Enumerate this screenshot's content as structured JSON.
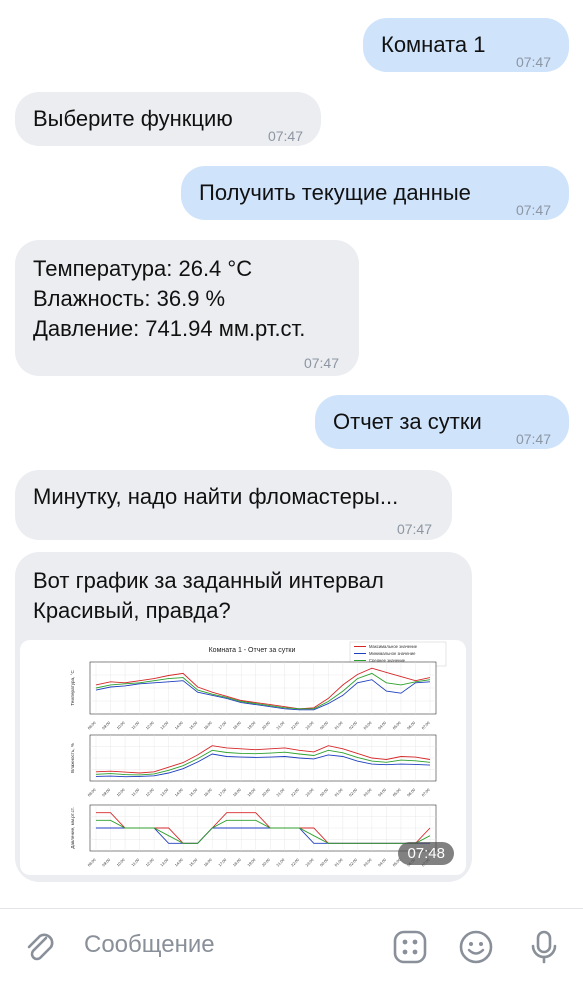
{
  "messages": [
    {
      "dir": "out",
      "text": "Комната 1",
      "time": "07:47"
    },
    {
      "dir": "in",
      "text": "Выберите функцию",
      "time": "07:47"
    },
    {
      "dir": "out",
      "text": "Получить текущие данные",
      "time": "07:47"
    },
    {
      "dir": "in",
      "lines": [
        "Температура: 26.4 °C",
        "Влажность: 36.9 %",
        "Давление: 741.94 мм.рт.ст."
      ],
      "time": "07:47"
    },
    {
      "dir": "out",
      "text": "Отчет за сутки",
      "time": "07:47"
    },
    {
      "dir": "in",
      "text": "Минутку, надо найти фломастеры...",
      "time": "07:47"
    },
    {
      "dir": "in",
      "lines": [
        "Вот график за заданный интервал",
        "Красивый, правда?"
      ],
      "image_time": "07:48"
    }
  ],
  "composer": {
    "placeholder": "Сообщение",
    "icons": [
      "attach-icon",
      "keypad-icon",
      "emoji-icon",
      "microphone-icon"
    ]
  },
  "colors": {
    "outgoing": "#cfe3fb",
    "incoming": "#ebedf0",
    "timestamp": "#8d96a3"
  },
  "chart_data": [
    {
      "type": "line",
      "title": "Комната 1 - Отчет за сутки",
      "legend": [
        "Максимальное значение",
        "Минимальное значение",
        "Среднее значение"
      ],
      "legend_position": "top-right",
      "ylabel": "Температура, °C",
      "x": [
        "08:00",
        "09:00",
        "10:00",
        "11:00",
        "12:00",
        "13:00",
        "14:00",
        "15:00",
        "16:00",
        "17:00",
        "18:00",
        "19:00",
        "20:00",
        "21:00",
        "22:00",
        "23:00",
        "00:00",
        "01:00",
        "02:00",
        "03:00",
        "04:00",
        "05:00",
        "06:00",
        "07:00"
      ],
      "ylim": [
        23,
        28
      ],
      "series": [
        {
          "name": "Максимальное значение",
          "color": "#d62728",
          "values": [
            25.8,
            26.1,
            26.0,
            26.2,
            26.4,
            26.7,
            26.9,
            25.6,
            25.1,
            24.7,
            24.3,
            24.1,
            23.9,
            23.7,
            23.5,
            23.6,
            24.5,
            25.8,
            26.8,
            27.4,
            27.0,
            26.6,
            26.2,
            26.5
          ]
        },
        {
          "name": "Минимальное значение",
          "color": "#1f3fbf",
          "values": [
            25.3,
            25.6,
            25.7,
            25.9,
            26.0,
            26.1,
            26.2,
            25.1,
            24.8,
            24.5,
            24.1,
            23.9,
            23.7,
            23.5,
            23.4,
            23.4,
            24.0,
            24.8,
            26.0,
            26.3,
            25.2,
            25.0,
            26.0,
            26.1
          ]
        },
        {
          "name": "Среднее значение",
          "color": "#2ca02c",
          "values": [
            25.5,
            25.8,
            25.9,
            26.0,
            26.2,
            26.4,
            26.5,
            25.3,
            24.9,
            24.6,
            24.2,
            24.0,
            23.8,
            23.6,
            23.5,
            23.5,
            24.2,
            25.2,
            26.4,
            26.9,
            26.0,
            25.8,
            26.1,
            26.3
          ]
        }
      ]
    },
    {
      "type": "line",
      "ylabel": "Влажность, %",
      "x": [
        "08:00",
        "09:00",
        "10:00",
        "11:00",
        "12:00",
        "13:00",
        "14:00",
        "15:00",
        "16:00",
        "17:00",
        "18:00",
        "19:00",
        "20:00",
        "21:00",
        "22:00",
        "23:00",
        "00:00",
        "01:00",
        "02:00",
        "03:00",
        "04:00",
        "05:00",
        "06:00",
        "07:00"
      ],
      "ylim": [
        30,
        45
      ],
      "series": [
        {
          "name": "Максимальное значение",
          "color": "#d62728",
          "values": [
            33.0,
            33.2,
            32.9,
            32.6,
            33.0,
            34.5,
            36.0,
            38.5,
            41.5,
            40.8,
            40.5,
            40.2,
            40.5,
            40.8,
            40.0,
            39.5,
            41.5,
            40.5,
            39.0,
            37.5,
            37.0,
            38.0,
            37.8,
            37.0
          ]
        },
        {
          "name": "Минимальное значение",
          "color": "#1f3fbf",
          "values": [
            31.5,
            31.6,
            31.4,
            31.5,
            31.7,
            32.6,
            34.0,
            36.2,
            38.8,
            38.0,
            37.8,
            37.7,
            37.8,
            38.0,
            37.5,
            37.2,
            38.5,
            38.0,
            36.5,
            35.5,
            35.3,
            35.5,
            35.4,
            35.2
          ]
        },
        {
          "name": "Среднее значение",
          "color": "#2ca02c",
          "values": [
            32.2,
            32.4,
            32.1,
            32.0,
            32.3,
            33.5,
            35.0,
            37.3,
            40.0,
            39.3,
            39.0,
            38.9,
            39.1,
            39.4,
            38.8,
            38.3,
            40.0,
            39.2,
            37.7,
            36.5,
            36.1,
            36.8,
            36.6,
            36.1
          ]
        }
      ]
    },
    {
      "type": "line",
      "ylabel": "Давление, мм.рт.ст.",
      "x": [
        "08:00",
        "09:00",
        "10:00",
        "11:00",
        "12:00",
        "13:00",
        "14:00",
        "15:00",
        "16:00",
        "17:00",
        "18:00",
        "19:00",
        "20:00",
        "21:00",
        "22:00",
        "23:00",
        "00:00",
        "01:00",
        "02:00",
        "03:00",
        "04:00",
        "05:00",
        "06:00",
        "07:00"
      ],
      "ylim": [
        740.5,
        743.5
      ],
      "series": [
        {
          "name": "Максимальное значение",
          "color": "#d62728",
          "values": [
            743.0,
            743.0,
            742.0,
            742.0,
            742.0,
            742.0,
            741.0,
            741.0,
            742.0,
            743.0,
            743.0,
            743.0,
            742.0,
            742.0,
            742.0,
            742.0,
            741.0,
            741.0,
            741.0,
            741.0,
            741.0,
            741.0,
            741.0,
            742.0
          ]
        },
        {
          "name": "Минимальное значение",
          "color": "#1f3fbf",
          "values": [
            742.0,
            742.0,
            742.0,
            742.0,
            742.0,
            741.0,
            741.0,
            741.0,
            742.0,
            742.0,
            742.0,
            742.0,
            742.0,
            742.0,
            742.0,
            741.0,
            741.0,
            741.0,
            741.0,
            741.0,
            741.0,
            741.0,
            741.0,
            741.0
          ]
        },
        {
          "name": "Среднее значение",
          "color": "#2ca02c",
          "values": [
            742.5,
            742.5,
            742.0,
            742.0,
            742.0,
            741.5,
            741.0,
            741.0,
            742.0,
            742.5,
            742.5,
            742.5,
            742.0,
            742.0,
            742.0,
            741.5,
            741.0,
            741.0,
            741.0,
            741.0,
            741.0,
            741.0,
            741.0,
            741.5
          ]
        }
      ]
    }
  ]
}
